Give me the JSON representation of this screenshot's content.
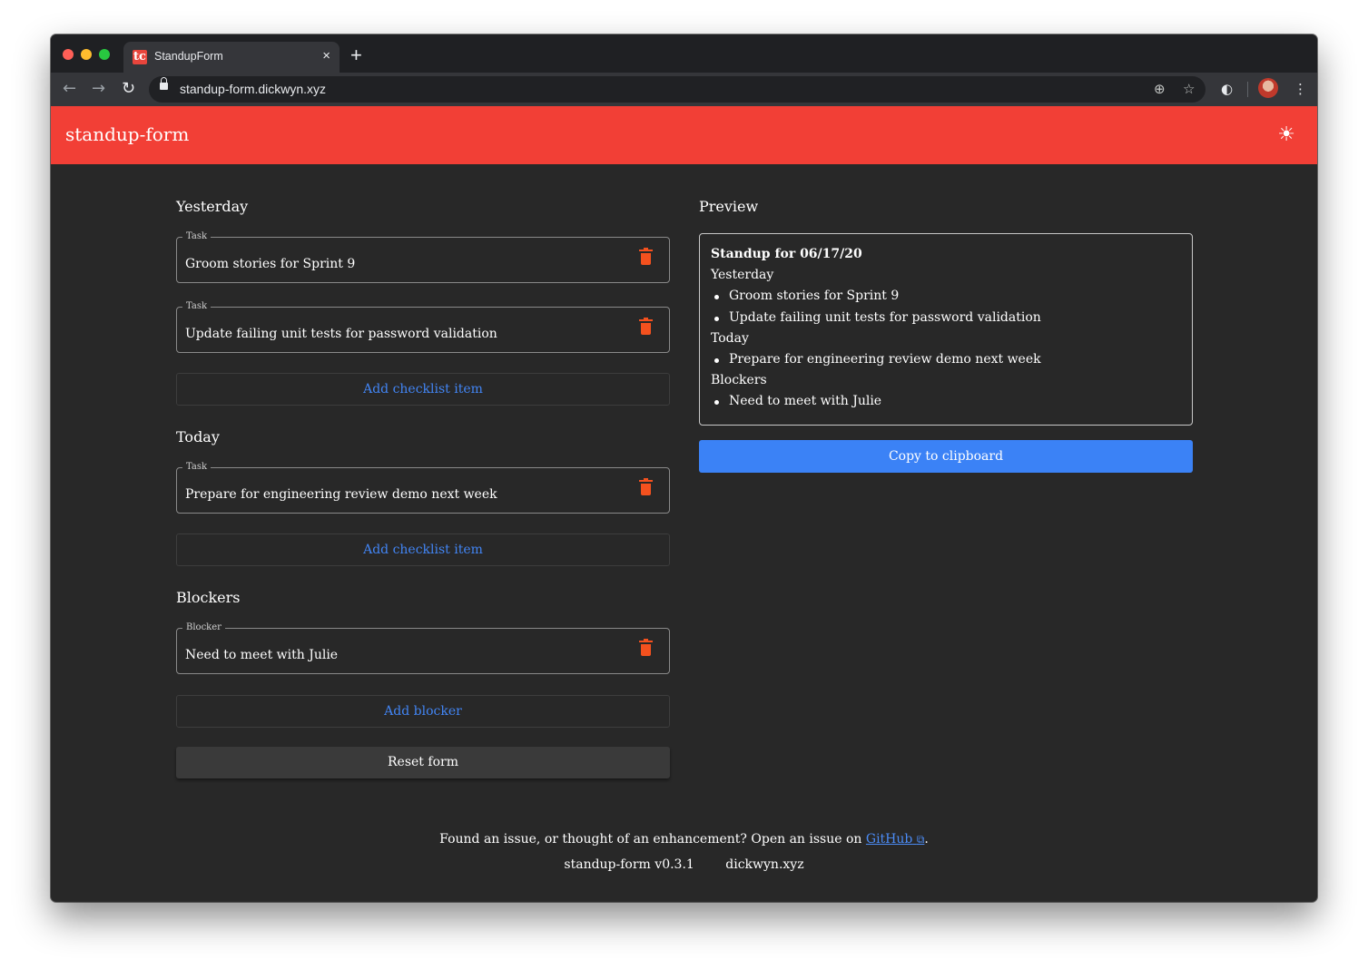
{
  "browser": {
    "tab_title": "StandupForm",
    "tab_favicon": "tc",
    "tab_close": "×",
    "new_tab": "+",
    "url": "standup-form.dickwyn.xyz"
  },
  "appbar": {
    "title": "standup-form",
    "theme_icon": "☀"
  },
  "sections": {
    "yesterday": {
      "title": "Yesterday",
      "tasks": [
        {
          "legend": "Task",
          "value": "Groom stories for Sprint 9"
        },
        {
          "legend": "Task",
          "value": "Update failing unit tests for password validation"
        }
      ],
      "add_label": "Add checklist item"
    },
    "today": {
      "title": "Today",
      "tasks": [
        {
          "legend": "Task",
          "value": "Prepare for engineering review demo next week"
        }
      ],
      "add_label": "Add checklist item"
    },
    "blockers": {
      "title": "Blockers",
      "tasks": [
        {
          "legend": "Blocker",
          "value": "Need to meet with Julie"
        }
      ],
      "add_label": "Add blocker"
    },
    "reset_label": "Reset form"
  },
  "preview": {
    "title": "Preview",
    "heading": "Standup for 06/17/20",
    "yesterday_label": "Yesterday",
    "yesterday_items": [
      "Groom stories for Sprint 9",
      "Update failing unit tests for password validation"
    ],
    "today_label": "Today",
    "today_items": [
      "Prepare for engineering review demo next week"
    ],
    "blockers_label": "Blockers",
    "blockers_items": [
      "Need to meet with Julie"
    ],
    "copy_label": "Copy to clipboard"
  },
  "footer": {
    "text": "Found an issue, or thought of an enhancement? Open an issue on",
    "link": "GitHub",
    "external_icon": "⧉",
    "period": ".",
    "version": "standup-form v0.3.1",
    "site": "dickwyn.xyz"
  },
  "colors": {
    "accent": "#f23f36",
    "primary": "#3b82f6",
    "background": "#282828",
    "trash": "#f4511e"
  }
}
